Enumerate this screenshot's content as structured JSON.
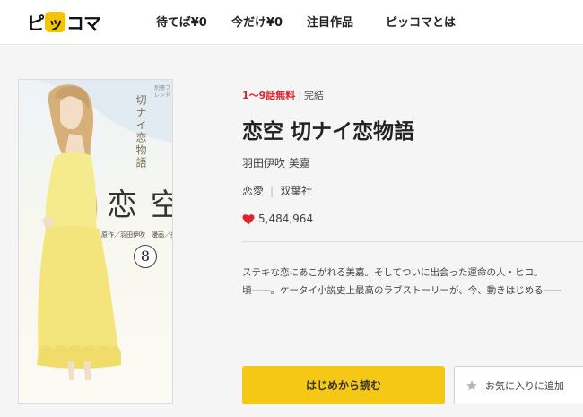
{
  "header": {
    "logo": {
      "part1": "ピ",
      "badge": "ッ",
      "part2": "コマ"
    },
    "nav": [
      {
        "label": "待てば¥0"
      },
      {
        "label": "今だけ¥0"
      },
      {
        "label": "注目作品"
      },
      {
        "label": "ピッコマとは"
      }
    ]
  },
  "cover": {
    "series": "切ナイ恋物語",
    "title": "恋 空",
    "authors": "原作／羽田伊吹　漫画／美嘉",
    "volume": "8",
    "label": "別冊フレンド"
  },
  "detail": {
    "free_episodes": "1〜9話無料",
    "status": "完結",
    "title": "恋空 切ナイ恋物語",
    "author": "羽田伊吹 美嘉",
    "genre": "恋愛",
    "publisher": "双葉社",
    "likes": "5,484,964",
    "description_line1": "ステキな恋にあこがれる美嘉。そしてついに出会った運命の人・ヒロ。",
    "description_line2": "頃――。ケータイ小説史上最高のラブストーリーが、今、動きはじめる――",
    "heart_color": "#e2232b",
    "accent_color": "#f5c816"
  },
  "actions": {
    "read_label": "はじめから読む",
    "favorite_label": "お気に入りに追加"
  }
}
